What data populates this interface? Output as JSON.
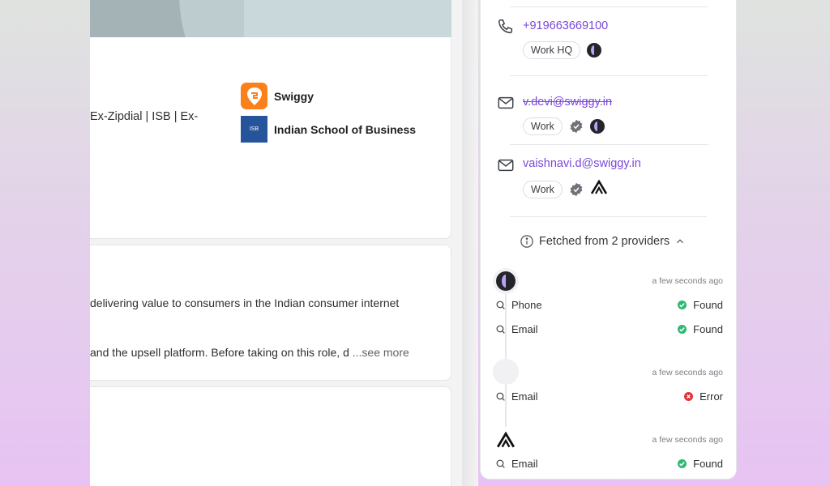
{
  "profile": {
    "headline": "Ex-Zipdial | ISB | Ex-",
    "companies": [
      {
        "name": "Swiggy",
        "logo": "swiggy-logo",
        "color": "#fc8019"
      },
      {
        "name": "Indian School of Business",
        "logo": "isb-logo",
        "logo_text": "ISB",
        "color": "#26549b"
      }
    ],
    "about": {
      "line1": "delivering value to consumers in the Indian consumer internet",
      "line2": "and the upsell platform. Before taking on this role, d",
      "see_more": "...see more"
    }
  },
  "contacts": [
    {
      "type": "phone",
      "icon": "phone-icon",
      "value": "+919663669100",
      "tag": "Work HQ",
      "strikethrough": false
    },
    {
      "type": "email",
      "icon": "mail-icon",
      "value": "v.devi@swiggy.in",
      "tag": "Work",
      "strikethrough": true
    },
    {
      "type": "email",
      "icon": "mail-icon",
      "value": "vaishnavi.d@swiggy.in",
      "tag": "Work",
      "strikethrough": false
    }
  ],
  "fetched": {
    "label": "Fetched from 2 providers",
    "icon": "info-icon",
    "toggle": "chevron-up-icon"
  },
  "providers": [
    {
      "avatar": "provider-a-icon",
      "time": "a few seconds ago",
      "rows": [
        {
          "label": "Phone",
          "status": "Found"
        },
        {
          "label": "Email",
          "status": "Found"
        }
      ]
    },
    {
      "avatar": "provider-unknown-icon",
      "time": "a few seconds ago",
      "rows": [
        {
          "label": "Email",
          "status": "Error"
        }
      ]
    },
    {
      "avatar": "provider-b-icon",
      "time": "a few seconds ago",
      "rows": [
        {
          "label": "Email",
          "status": "Found"
        }
      ]
    }
  ],
  "colors": {
    "accent": "#7a47db",
    "found": "#2eb872",
    "error": "#e0343a"
  }
}
